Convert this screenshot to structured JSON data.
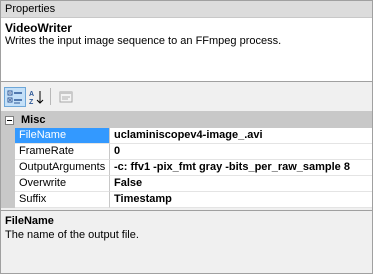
{
  "panel": {
    "title": "Properties"
  },
  "header": {
    "component_name": "VideoWriter",
    "component_description": "Writes the input image sequence to an FFmpeg process."
  },
  "toolbar": {
    "buttons": [
      {
        "name": "categorized",
        "icon": "categorized-icon",
        "active": true
      },
      {
        "name": "alphabetical",
        "icon": "sort-az-icon",
        "active": false
      },
      {
        "name": "property-pages",
        "icon": "property-pages-icon",
        "active": false,
        "disabled": true
      }
    ]
  },
  "grid": {
    "category": "Misc",
    "properties": [
      {
        "name": "FileName",
        "value": "uclaminiscopev4-image_.avi"
      },
      {
        "name": "FrameRate",
        "value": "0"
      },
      {
        "name": "OutputArguments",
        "value": "-c: ffv1 -pix_fmt gray -bits_per_raw_sample 8"
      },
      {
        "name": "Overwrite",
        "value": "False"
      },
      {
        "name": "Suffix",
        "value": "Timestamp"
      }
    ],
    "selected_property": "FileName"
  },
  "description": {
    "name": "FileName",
    "text": "The name of the output file."
  },
  "colors": {
    "selection": "#3399ff",
    "category_band": "#c8c8c8",
    "active_button": "#c4e0f8"
  }
}
